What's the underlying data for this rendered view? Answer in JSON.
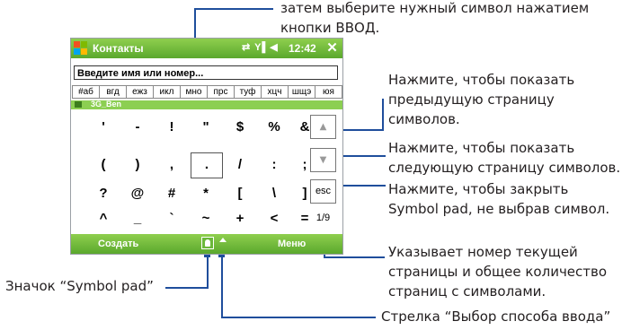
{
  "annotations": {
    "top_line1": "затем выберите нужный символ нажатием",
    "top_line2": "кнопки ВВОД.",
    "prev_line1": "Нажмите, чтобы показать",
    "prev_line2": "предыдущую страницу",
    "prev_line3": "символов.",
    "next_line1": "Нажмите, чтобы показать",
    "next_line2": "следующую страницу символов.",
    "esc_line1": "Нажмите, чтобы закрыть",
    "esc_line2": "Symbol pad, не выбрав символ.",
    "page_line1": "Указывает номер текущей",
    "page_line2": "страницы и общее количество",
    "page_line3": "страниц с символами.",
    "symbolpad_label": "Значок “Symbol pad”",
    "arrow_label": "Стрелка “Выбор способа ввода”"
  },
  "device": {
    "title": "Контакты",
    "status_icons": "⇄ Y▌◀ ",
    "time": "12:42",
    "close": "✕",
    "input_value": "Введите имя или номер...",
    "tabs": [
      "#аб",
      "вгд",
      "ежз",
      "икл",
      "мно",
      "прс",
      "туф",
      "хцч",
      "шщэ",
      "юя"
    ],
    "contact_row": "3G_Ben",
    "symbols": [
      [
        "'",
        "-",
        "!",
        "\"",
        "$",
        "%",
        "&"
      ],
      [
        "(",
        ")",
        ",",
        ".",
        "/",
        ":",
        ";"
      ],
      [
        "?",
        "@",
        "#",
        "*",
        "[",
        "\\",
        "]"
      ],
      [
        "^",
        "_",
        "`",
        "~",
        "+",
        "<",
        "="
      ]
    ],
    "up_button": "▲",
    "down_button": "▼",
    "esc_button": "esc",
    "page_indicator": "1/9",
    "menu_left": "Создать",
    "menu_right": "Меню"
  },
  "colors": {
    "accent_green": "#5aa82d",
    "callout_blue": "#1f4e9c"
  }
}
